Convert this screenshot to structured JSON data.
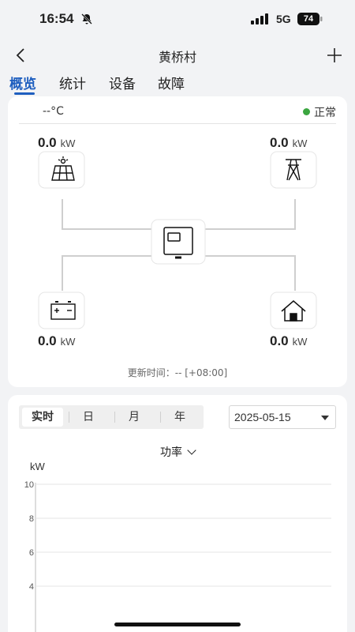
{
  "status_bar": {
    "time": "16:54",
    "network": "5G",
    "battery": "74"
  },
  "nav": {
    "title": "黄桥村"
  },
  "tabs": [
    {
      "label": "概览",
      "active": true
    },
    {
      "label": "统计",
      "active": false
    },
    {
      "label": "设备",
      "active": false
    },
    {
      "label": "故障",
      "active": false
    }
  ],
  "overview": {
    "temperature": "--°C",
    "status": "正常",
    "status_color": "#3ba640",
    "unit": "kW",
    "solar": {
      "value": "0.0",
      "icon": "solar-panel-icon"
    },
    "grid": {
      "value": "0.0",
      "icon": "power-tower-icon"
    },
    "inverter": {
      "icon": "inverter-icon"
    },
    "battery": {
      "value": "0.0",
      "icon": "battery-icon"
    },
    "home": {
      "value": "0.0",
      "icon": "home-icon"
    },
    "update_time": "更新时间：-- [+08:00]"
  },
  "period": {
    "options": [
      "实时",
      "日",
      "月",
      "年"
    ],
    "selected": "实时",
    "date": "2025-05-15"
  },
  "chart_data": {
    "type": "line",
    "title": "功率",
    "ylabel": "kW",
    "yticks": [
      10,
      8,
      6,
      4
    ],
    "ylim": [
      0,
      10
    ],
    "grid": true,
    "series": []
  },
  "colors": {
    "accent": "#1f5fbf",
    "ok": "#3ba640"
  }
}
